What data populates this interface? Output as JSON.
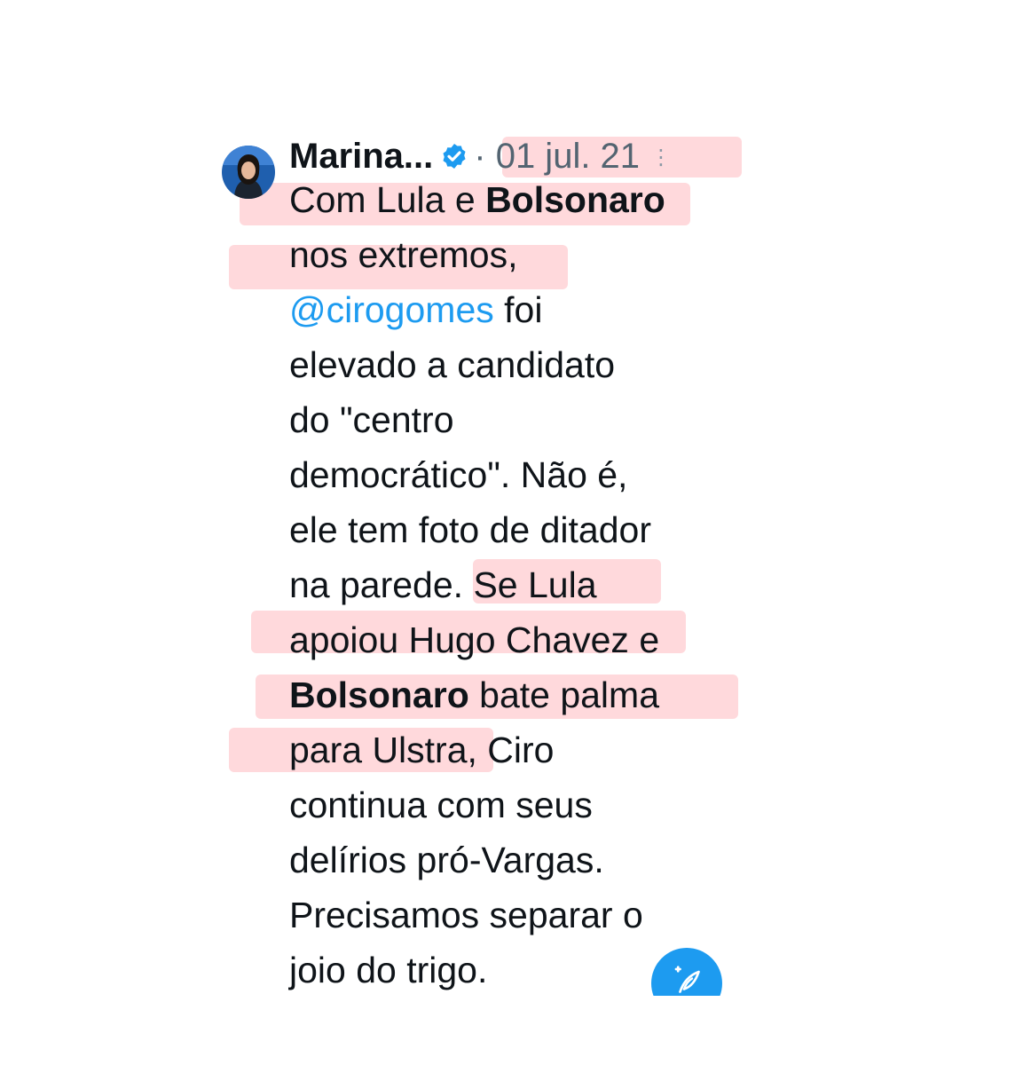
{
  "tweet": {
    "author": "Marina...",
    "date": "· 01 jul. 21",
    "more_icon": "⋮",
    "lines": [
      {
        "parts": [
          {
            "t": "Com Lula e ",
            "s": ""
          },
          {
            "t": "Bolsonaro",
            "s": "bold"
          }
        ]
      },
      {
        "parts": [
          {
            "t": "nos extremos,",
            "s": ""
          }
        ]
      },
      {
        "parts": [
          {
            "t": "@cirogomes",
            "s": "mention"
          },
          {
            "t": " foi",
            "s": ""
          }
        ]
      },
      {
        "parts": [
          {
            "t": "elevado a candidato",
            "s": ""
          }
        ]
      },
      {
        "parts": [
          {
            "t": "do \"centro",
            "s": ""
          }
        ]
      },
      {
        "parts": [
          {
            "t": "democrático\". Não é,",
            "s": ""
          }
        ]
      },
      {
        "parts": [
          {
            "t": "ele tem foto de ditador",
            "s": ""
          }
        ]
      },
      {
        "parts": [
          {
            "t": "na parede. Se Lula",
            "s": ""
          }
        ]
      },
      {
        "parts": [
          {
            "t": "apoiou Hugo Chavez e",
            "s": ""
          }
        ]
      },
      {
        "parts": [
          {
            "t": "Bolsonaro",
            "s": "bold"
          },
          {
            "t": " bate palma",
            "s": ""
          }
        ]
      },
      {
        "parts": [
          {
            "t": "para Ulstra, Ciro",
            "s": ""
          }
        ]
      },
      {
        "parts": [
          {
            "t": "continua com seus",
            "s": ""
          }
        ]
      },
      {
        "parts": [
          {
            "t": "delírios pró-Vargas.",
            "s": ""
          }
        ]
      },
      {
        "parts": [
          {
            "t": "Precisamos separar o",
            "s": ""
          }
        ]
      },
      {
        "parts": [
          {
            "t": "joio do trigo.",
            "s": ""
          }
        ]
      }
    ]
  },
  "icons": {
    "verified": "verified-badge-icon",
    "compose": "compose-tweet-icon",
    "avatar": "profile-avatar"
  },
  "colors": {
    "text": "#0f1419",
    "muted": "#536471",
    "accent": "#1d9bf0",
    "highlight": "#ff7882"
  }
}
